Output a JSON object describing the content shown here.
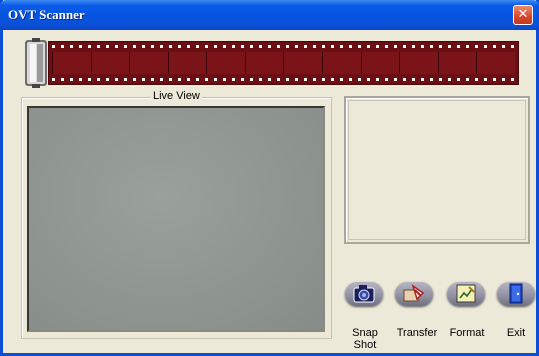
{
  "window": {
    "title": "OVT Scanner",
    "close_glyph": "✕"
  },
  "film_strip": {
    "frame_count": 12,
    "icon": "film-canister-icon"
  },
  "live_view": {
    "label": "Live  View"
  },
  "buttons": [
    {
      "key": "snap",
      "label": "Snap Shot",
      "icon": "camera-icon"
    },
    {
      "key": "transfer",
      "label": "Transfer",
      "icon": "transfer-icon"
    },
    {
      "key": "format",
      "label": "Format",
      "icon": "format-icon"
    },
    {
      "key": "exit",
      "label": "Exit",
      "icon": "exit-door-icon"
    }
  ],
  "colors": {
    "title_bar": "#0a5ce8",
    "film": "#6b0f14",
    "live_view": "#8f9690",
    "window_bg": "#ece9d8"
  }
}
